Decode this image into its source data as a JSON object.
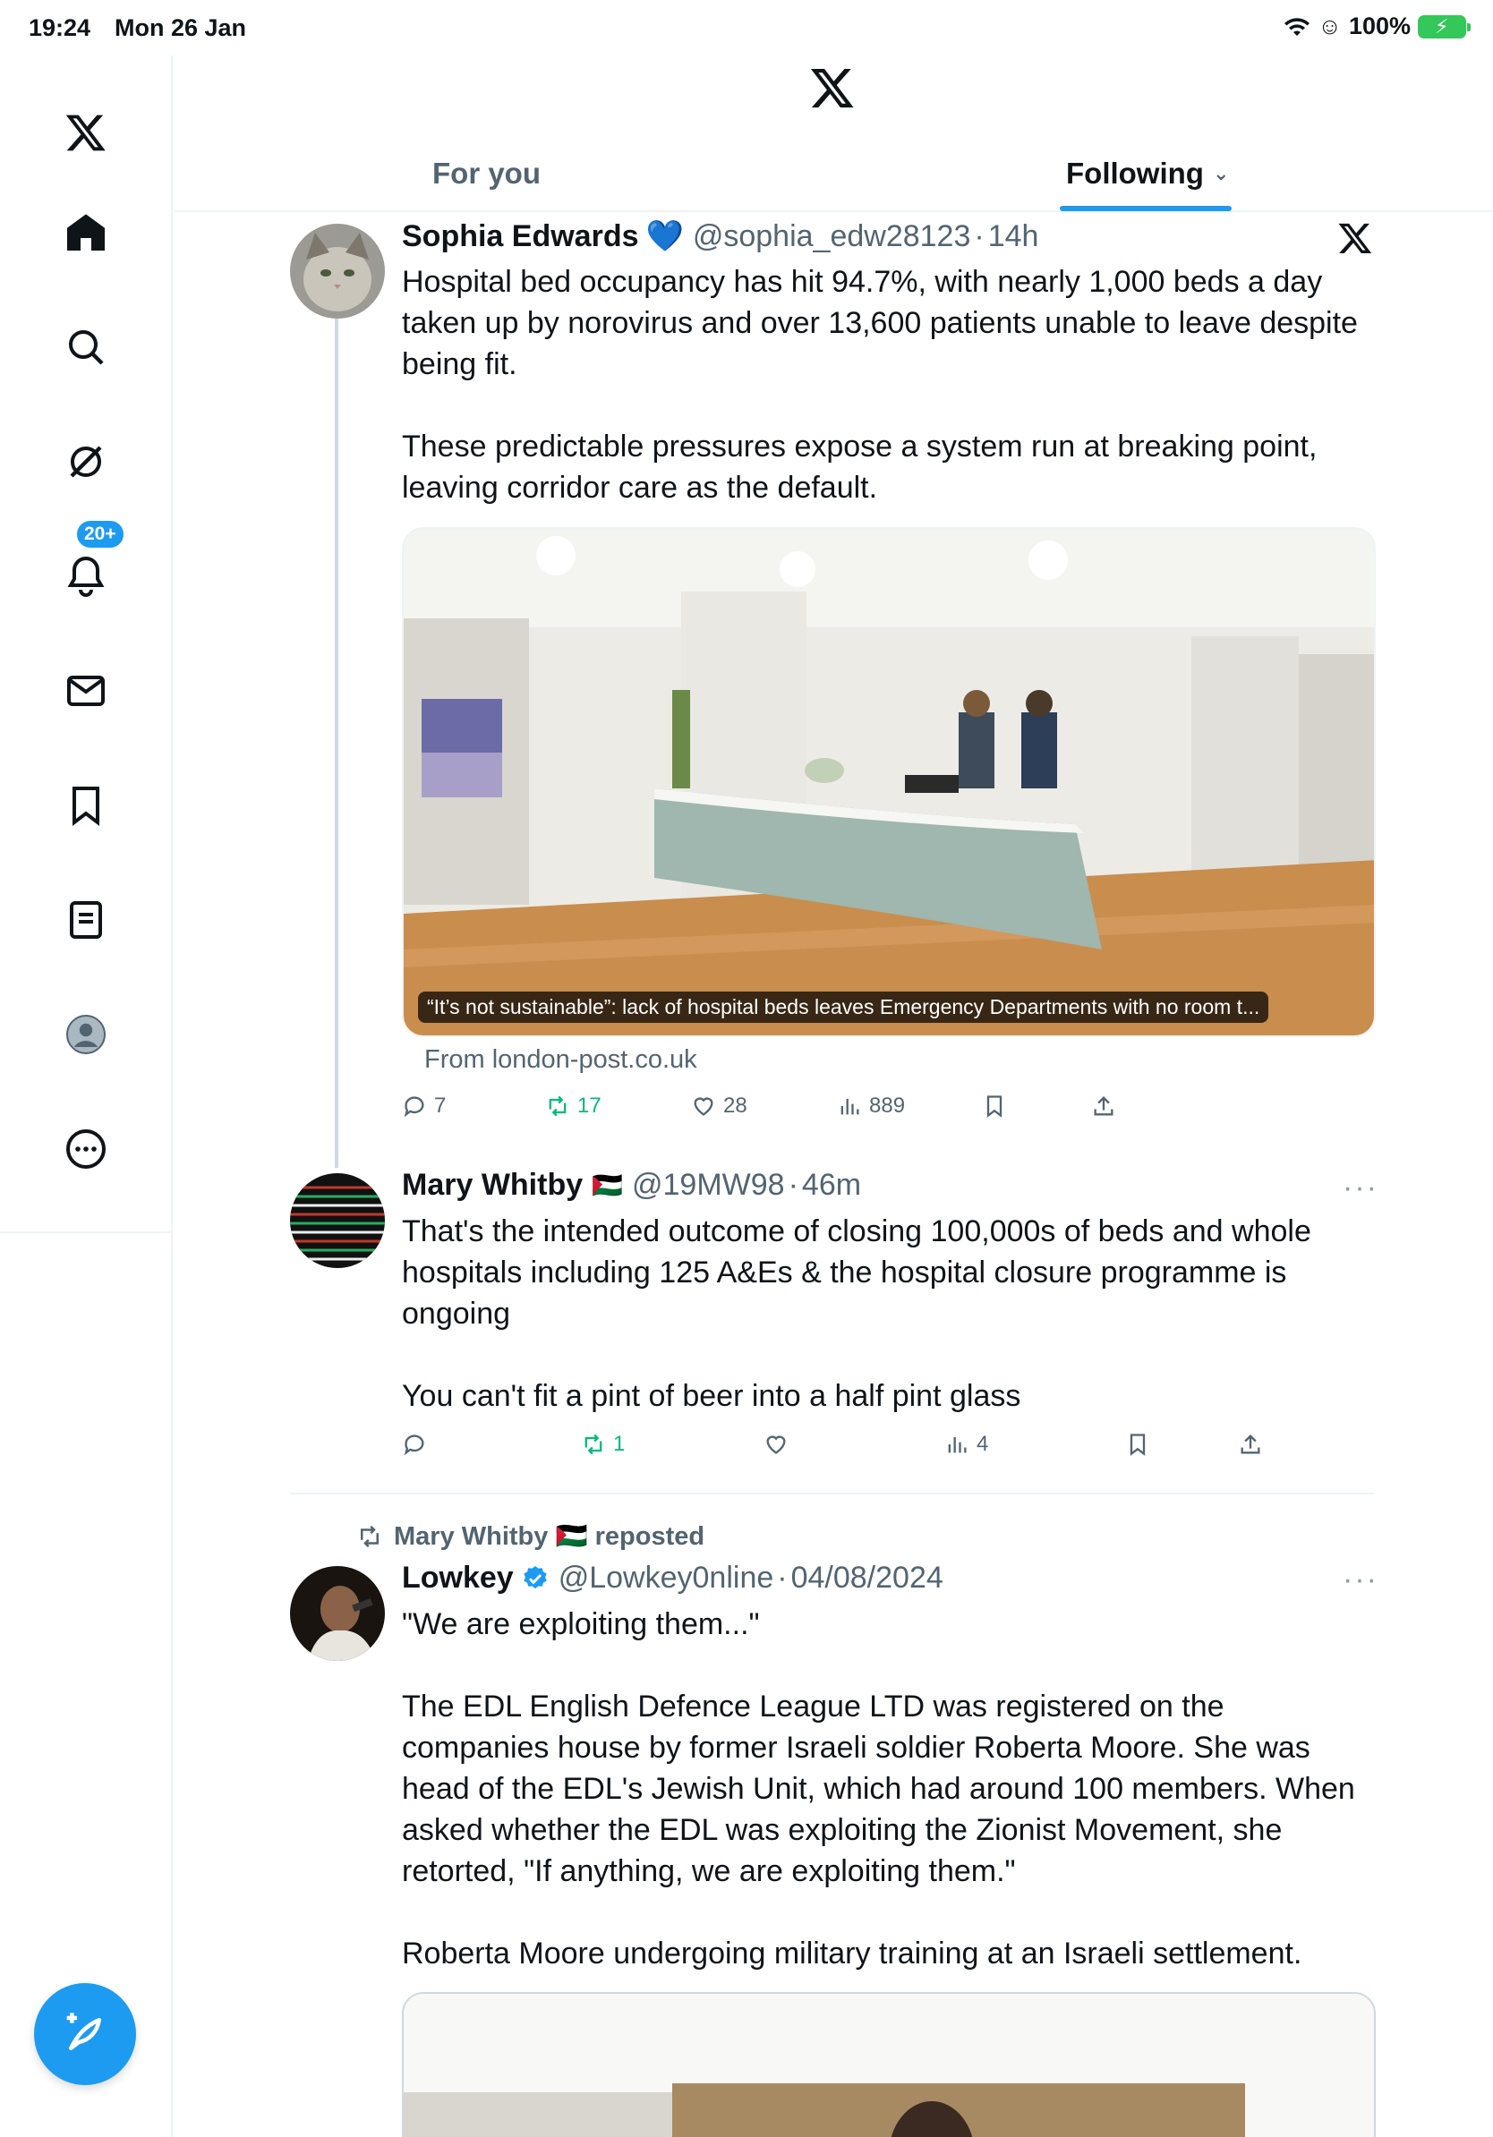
{
  "status": {
    "time": "19:24",
    "date": "Mon 26 Jan",
    "battery": "100%"
  },
  "sidebar": {
    "items": [
      "x-logo",
      "home",
      "search",
      "grok",
      "notifications",
      "messages",
      "bookmarks",
      "lists",
      "profile",
      "more"
    ],
    "notifications_badge": "20+"
  },
  "tabs": {
    "for_you": "For you",
    "following": "Following"
  },
  "tweet1": {
    "name": "Sophia Edwards",
    "emoji": "💙",
    "handle": "@sophia_edw28123",
    "dot": "·",
    "time": "14h",
    "text": "Hospital bed occupancy has hit 94.7%, with nearly 1,000 beds a day taken up by norovirus and over 13,600 patients unable to leave despite being fit.\n\nThese predictable pressures expose a system run at breaking point, leaving corridor care as the default.",
    "card_caption": "“It’s not sustainable”: lack of hospital beds leaves Emergency Departments with no room t...",
    "card_from": "From london-post.co.uk",
    "replies": "7",
    "reposts": "17",
    "likes": "28",
    "views": "889"
  },
  "tweet2": {
    "name": "Mary Whitby",
    "flag": "🇵🇸",
    "handle": "@19MW98",
    "dot": "·",
    "time": "46m",
    "text": "That's the intended outcome of closing 100,000s of beds and whole hospitals including 125 A&Es & the hospital closure programme is ongoing\n\nYou can't fit a pint of beer into a half pint glass",
    "replies": "",
    "reposts": "1",
    "likes": "",
    "views": "4"
  },
  "tweet3": {
    "repost_label": "Mary Whitby 🇵🇸 reposted",
    "name": "Lowkey",
    "handle": "@Lowkey0nline",
    "dot": "·",
    "time": "04/08/2024",
    "text": "\"We are exploiting them...\"\n\nThe EDL English Defence League LTD was registered on the companies house by former Israeli soldier Roberta Moore. She was head of the EDL's Jewish Unit, which had around 100 members. When asked whether the EDL was exploiting the Zionist Movement, she retorted, \"If anything, we are exploiting them.\"\n\nRoberta Moore undergoing military training at an Israeli settlement."
  },
  "colors": {
    "accent": "#1d9bf0",
    "repost": "#00ba7c",
    "muted": "#536471"
  }
}
